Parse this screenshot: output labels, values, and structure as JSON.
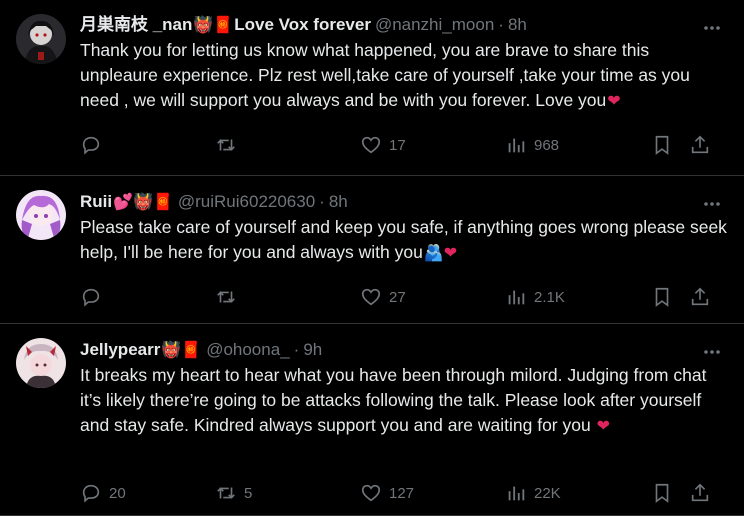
{
  "tweets": [
    {
      "display_name": "月巣南枝 _nan",
      "name_emojis": "👹🧧",
      "display_name_suffix": "Love Vox forever",
      "handle": "@nanzhi_moon",
      "time": "8h",
      "text": "Thank you for letting us know what happened, you are brave to share this unpleaure experience. Plz rest well,take care of yourself ,take your time as you need , we will support you always and be with you forever. Love you",
      "text_emoji": "❤",
      "replies": "",
      "retweets": "",
      "likes": "17",
      "views": "968"
    },
    {
      "display_name": "Ruii",
      "name_emojis": "💕👹🧧",
      "display_name_suffix": "",
      "handle": "@ruiRui60220630",
      "time": "8h",
      "text": "Please take care of yourself and keep you safe, if anything goes wrong please seek help, I'll be here for you and always with you",
      "text_emoji": "🫂❤",
      "replies": "",
      "retweets": "",
      "likes": "27",
      "views": "2.1K"
    },
    {
      "display_name": "Jellypearr",
      "name_emojis": "👹🧧",
      "display_name_suffix": "",
      "handle": "@ohoona_",
      "time": "9h",
      "text": "It breaks my heart to hear what you have been through milord. Judging from chat it’s likely there’re going to be attacks following the talk. Please look after yourself and stay safe. Kindred always support you and are waiting for you",
      "text_emoji": "❤",
      "replies": "20",
      "retweets": "5",
      "likes": "127",
      "views": "22K"
    }
  ],
  "colors": {
    "background": "#000000",
    "text": "#e7e9ea",
    "muted": "#71767b",
    "divider": "#2f3336",
    "heart": "#f91880"
  }
}
